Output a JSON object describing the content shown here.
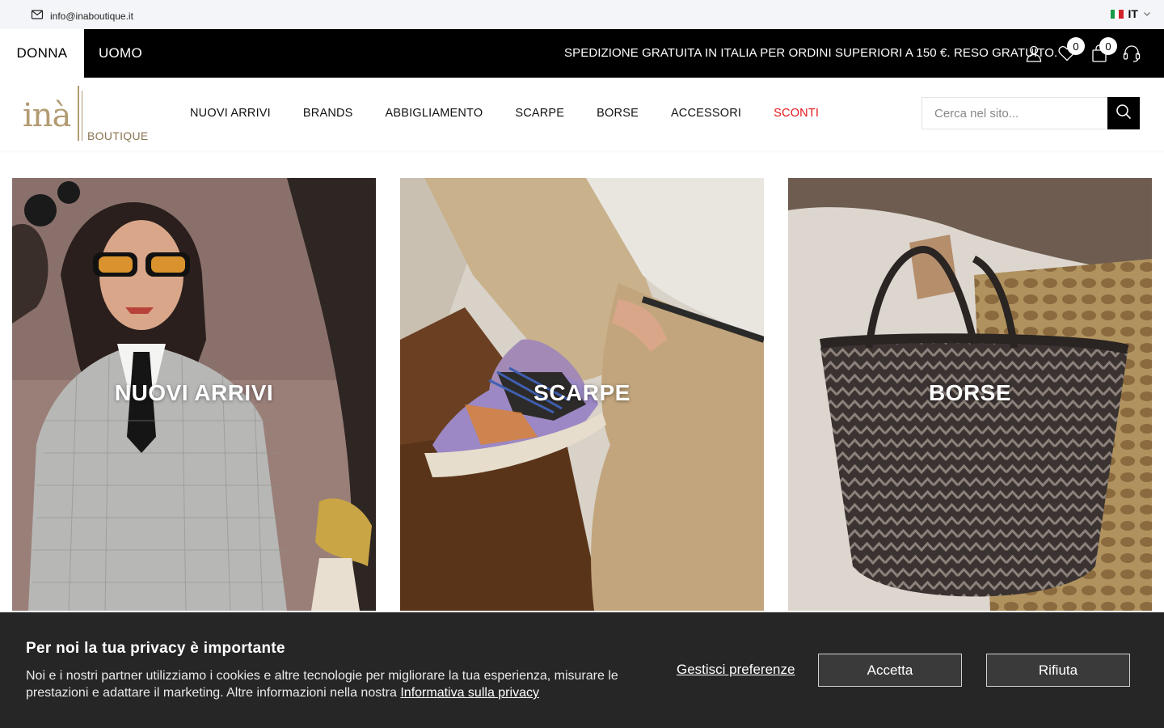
{
  "topbar": {
    "email": "info@inaboutique.it",
    "email_icon": "mail-icon",
    "language": "IT",
    "language_icon": "italy-flag-icon",
    "chevron_icon": "chevron-down-icon"
  },
  "blackbar": {
    "gender_tabs": [
      {
        "label": "DONNA",
        "active": true
      },
      {
        "label": "UOMO",
        "active": false
      }
    ],
    "shipping_message": "SPEDIZIONE GRATUITA IN ITALIA PER ORDINI SUPERIORI A 150 €. RESO GRATUITO.",
    "icons": {
      "account": "user-icon",
      "wishlist": "heart-icon",
      "wishlist_count": "0",
      "cart": "shopping-bag-icon",
      "cart_count": "0",
      "support": "headset-icon"
    }
  },
  "header": {
    "logo_text": "inà",
    "logo_subtext": "BOUTIQUE",
    "nav": [
      {
        "label": "NUOVI ARRIVI",
        "highlight": false
      },
      {
        "label": "BRANDS",
        "highlight": false
      },
      {
        "label": "ABBIGLIAMENTO",
        "highlight": false
      },
      {
        "label": "SCARPE",
        "highlight": false
      },
      {
        "label": "BORSE",
        "highlight": false
      },
      {
        "label": "ACCESSORI",
        "highlight": false
      },
      {
        "label": "SCONTI",
        "highlight": true
      }
    ],
    "search": {
      "placeholder": "Cerca nel sito...",
      "value": "",
      "icon": "search-icon"
    }
  },
  "categories": [
    {
      "title": "NUOVI ARRIVI"
    },
    {
      "title": "SCARPE"
    },
    {
      "title": "BORSE"
    }
  ],
  "cookie_banner": {
    "title": "Per noi la tua privacy è importante",
    "text": "Noi e i nostri partner utilizziamo i cookies e altre tecnologie per migliorare la tua esperienza, misurare le prestazioni e adattare il marketing. Altre informazioni nella nostra ",
    "link": "Informativa sulla privacy",
    "manage": "Gestisci preferenze",
    "accept": "Accetta",
    "reject": "Rifiuta"
  },
  "colors": {
    "brand_gold": "#b39b72",
    "sale_red": "#e3161b",
    "topbar_bg": "#f4f5f8",
    "cookie_bg": "#262626"
  }
}
